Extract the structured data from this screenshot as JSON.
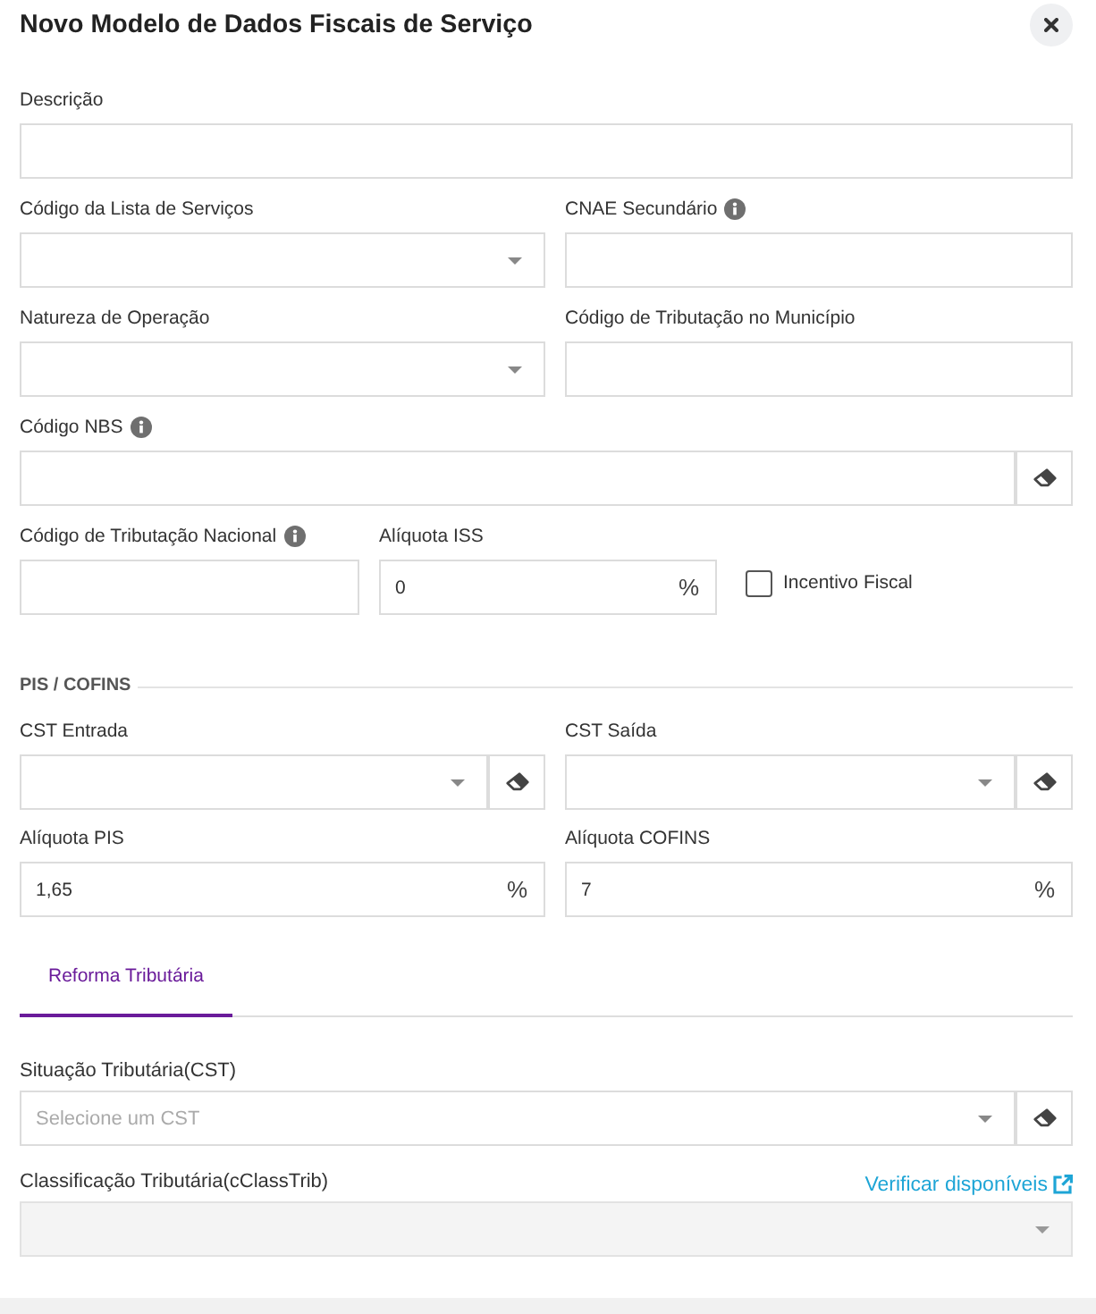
{
  "dialog": {
    "title": "Novo Modelo de Dados Fiscais de Serviço"
  },
  "form": {
    "rows": [
      [
        {
          "kind": "text",
          "label": "Descrição"
        }
      ],
      [
        {
          "kind": "select",
          "label": "Código da Lista de Serviços"
        },
        {
          "kind": "text",
          "label": "CNAE Secundário",
          "info": true
        }
      ],
      [
        {
          "kind": "select",
          "label": "Natureza de Operação"
        },
        {
          "kind": "text",
          "label": "Código de Tributação no Município"
        }
      ],
      [
        {
          "kind": "text",
          "label": "Código NBS",
          "info": true,
          "clear_button": true
        }
      ],
      [
        {
          "kind": "text",
          "label": "Código de Tributação Nacional",
          "info": true
        },
        {
          "kind": "percent",
          "label": "Alíquota ISS",
          "value": "0",
          "unit": "%"
        },
        {
          "kind": "checkbox",
          "label": "Incentivo Fiscal",
          "checked": false
        }
      ]
    ]
  },
  "pis_cofins": {
    "heading": "PIS / COFINS",
    "rows": [
      [
        {
          "kind": "select",
          "label": "CST Entrada",
          "clear_button": true
        },
        {
          "kind": "select",
          "label": "CST Saída",
          "clear_button": true
        }
      ],
      [
        {
          "kind": "percent",
          "label": "Alíquota PIS",
          "value": "1,65",
          "unit": "%"
        },
        {
          "kind": "percent",
          "label": "Alíquota COFINS",
          "value": "7",
          "unit": "%"
        }
      ]
    ]
  },
  "tabs": [
    {
      "label": "Reforma Tributária",
      "selected": true
    }
  ],
  "reforma": {
    "fields": [
      {
        "kind": "select",
        "label": "Situação Tributária(CST)",
        "placeholder": "Selecione um CST",
        "clear_button": true,
        "disabled": false
      },
      {
        "kind": "select",
        "label": "Classificação Tributária(cClassTrib)",
        "link": "Verificar disponíveis",
        "disabled": true
      }
    ]
  }
}
